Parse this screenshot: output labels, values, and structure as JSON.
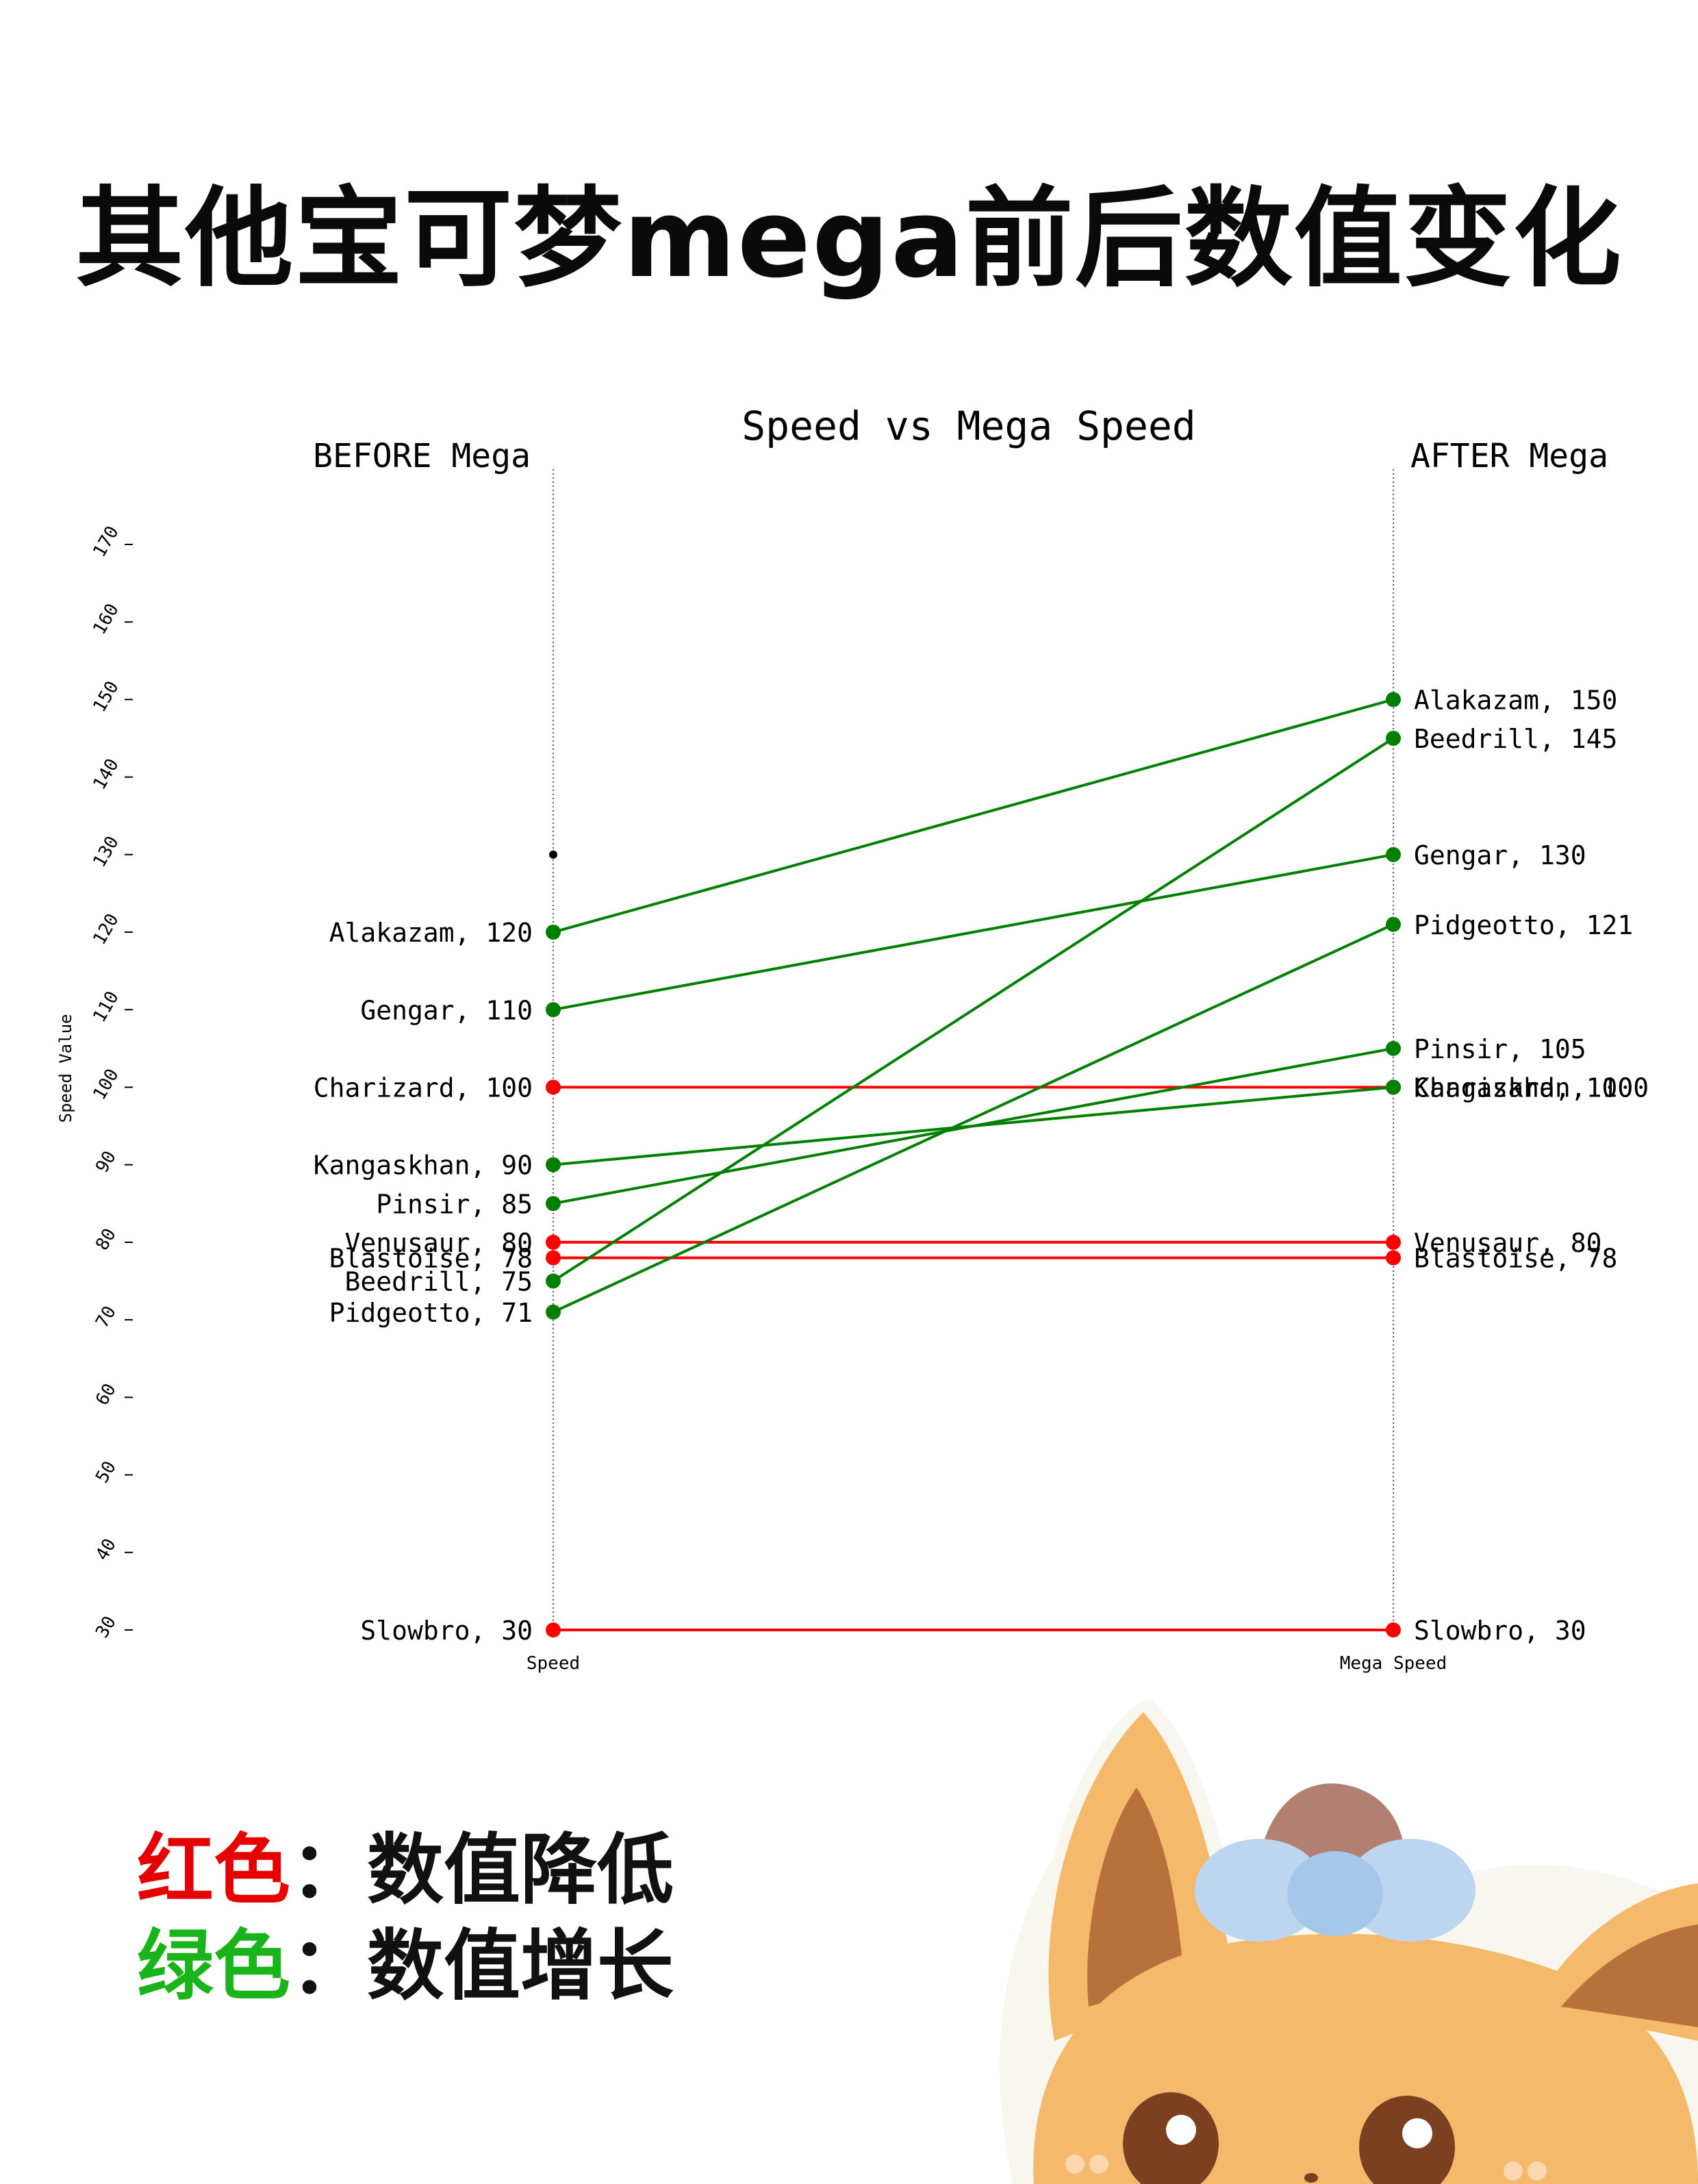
{
  "page": {
    "title": "其他宝可梦mega前后数值变化",
    "legend": [
      {
        "key": "红色",
        "sep": "：",
        "text": "数值降低",
        "color": "#e60000"
      },
      {
        "key": "绿色",
        "sep": "：",
        "text": "数值增长",
        "color": "#19b419"
      }
    ]
  },
  "colors": {
    "increase": "#008000",
    "decrease": "#ff0000",
    "text": "#000000"
  },
  "chart_data": {
    "type": "slope",
    "title": "Speed vs Mega Speed",
    "left_header": "BEFORE Mega",
    "right_header": "AFTER Mega",
    "ylabel": "Speed Value",
    "xlabels": [
      "Speed",
      "Mega Speed"
    ],
    "ylim": [
      30,
      170
    ],
    "yticks": [
      30,
      40,
      50,
      60,
      70,
      80,
      90,
      100,
      110,
      120,
      130,
      140,
      150,
      160,
      170
    ],
    "series": [
      {
        "name": "Alakazam",
        "before": 120,
        "after": 150,
        "change": "increase"
      },
      {
        "name": "Gengar",
        "before": 110,
        "after": 130,
        "change": "increase"
      },
      {
        "name": "Charizard",
        "before": 100,
        "after": 100,
        "change": "decrease"
      },
      {
        "name": "Kangaskhan",
        "before": 90,
        "after": 100,
        "change": "increase"
      },
      {
        "name": "Pinsir",
        "before": 85,
        "after": 105,
        "change": "increase"
      },
      {
        "name": "Venusaur",
        "before": 80,
        "after": 80,
        "change": "decrease"
      },
      {
        "name": "Blastoise",
        "before": 78,
        "after": 78,
        "change": "decrease"
      },
      {
        "name": "Beedrill",
        "before": 75,
        "after": 145,
        "change": "increase"
      },
      {
        "name": "Pidgeotto",
        "before": 71,
        "after": 121,
        "change": "increase"
      },
      {
        "name": "Slowbro",
        "before": 30,
        "after": 30,
        "change": "decrease"
      }
    ]
  }
}
